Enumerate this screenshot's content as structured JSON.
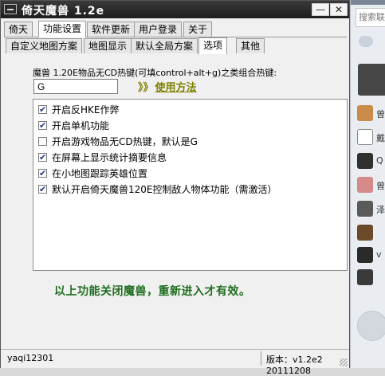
{
  "window": {
    "title": "倚天魔兽 1.2e",
    "minimize_glyph": "—",
    "close_glyph": "✕"
  },
  "main_tabs": [
    {
      "label": "倚天",
      "selected": false
    },
    {
      "label": "功能设置",
      "selected": true
    },
    {
      "label": "软件更新",
      "selected": false
    },
    {
      "label": "用户登录",
      "selected": false
    },
    {
      "label": "关于",
      "selected": false
    }
  ],
  "sub_tabs": [
    {
      "label": "自定义地图方案",
      "selected": false
    },
    {
      "label": "地图显示",
      "selected": false
    },
    {
      "label": "默认全局方案",
      "selected": false
    },
    {
      "label": "选项",
      "selected": true
    },
    {
      "label": "其他",
      "selected": false
    }
  ],
  "hotkey": {
    "label": "魔兽 1.20E物品无CD热键(可填control+alt+g)之类组合热键:",
    "value": "G",
    "usage_arrows": "》》",
    "usage_link": "使用方法"
  },
  "options": [
    {
      "label": "开启反HKE作弊",
      "checked": true
    },
    {
      "label": "开启单机功能",
      "checked": true
    },
    {
      "label": "开启游戏物品无CD热键，默认是G",
      "checked": false
    },
    {
      "label": "在屏幕上显示统计摘要信息",
      "checked": true
    },
    {
      "label": "在小地图跟踪英雄位置",
      "checked": true
    },
    {
      "label": "默认开启倚天魔兽120E控制敌人物体功能（需激活）",
      "checked": true
    }
  ],
  "notice": "以上功能关闭魔兽，重新进入才有效。",
  "status": {
    "user": "yaqi12301",
    "version": "版本：v1.2e2 20111208"
  },
  "qq_panel": {
    "search_placeholder": "搜索联系",
    "contacts": [
      {
        "initial": "曾",
        "color": "#c98a4a"
      },
      {
        "initial": "戴",
        "color": "#ffffff"
      },
      {
        "initial": "Q",
        "color": "#303030"
      },
      {
        "initial": "曾",
        "color": "#d58a8a"
      },
      {
        "initial": "泽",
        "color": "#5a5a5a"
      },
      {
        "initial": "",
        "color": "#6a4a2a"
      },
      {
        "initial": "v",
        "color": "#2a2a2a"
      },
      {
        "initial": "",
        "color": "#3a3a3a"
      }
    ]
  },
  "colors": {
    "notice": "#1f6e1f",
    "link": "#808000",
    "titlebar": "#2a2a2a"
  }
}
